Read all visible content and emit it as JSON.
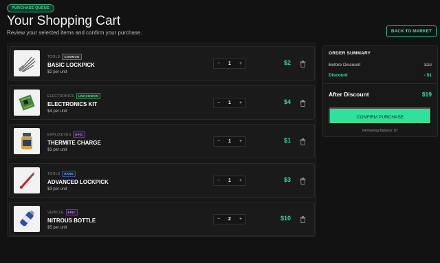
{
  "header": {
    "badge": "PURCHASE QUEUE",
    "title": "Your Shopping Cart",
    "subtitle": "Review your selected items and confirm your purchase.",
    "back_label": "BACK TO MARKET"
  },
  "items": [
    {
      "category": "TOOLS",
      "rarity": "COMMON",
      "name": "BASIC LOCKPICK",
      "unit": "$2 per unit",
      "qty": "1",
      "price": "$2",
      "icon": "lockpick-set-icon"
    },
    {
      "category": "ELECTRONICS",
      "rarity": "UNCOMMON",
      "name": "ELECTRONICS KIT",
      "unit": "$4 per unit",
      "qty": "1",
      "price": "$4",
      "icon": "circuit-board-icon"
    },
    {
      "category": "EXPLOSIVES",
      "rarity": "EPIC",
      "name": "THERMITE CHARGE",
      "unit": "$1 per unit",
      "qty": "1",
      "price": "$1",
      "icon": "thermite-jar-icon"
    },
    {
      "category": "TOOLS",
      "rarity": "RARE",
      "name": "ADVANCED LOCKPICK",
      "unit": "$3 per unit",
      "qty": "1",
      "price": "$3",
      "icon": "red-lockpick-icon"
    },
    {
      "category": "VEHICLE",
      "rarity": "EPIC",
      "name": "NITROUS BOTTLE",
      "unit": "$5 per unit",
      "qty": "2",
      "price": "$10",
      "icon": "nitrous-bottle-icon"
    }
  ],
  "stepper": {
    "minus": "−",
    "plus": "+"
  },
  "summary": {
    "title": "ORDER SUMMARY",
    "before_label": "Before Discount",
    "before_value": "$20",
    "discount_label": "Discount",
    "discount_value": "- $1",
    "after_label": "After Discount",
    "after_value": "$19",
    "confirm_label": "CONFIRM PURCHASE",
    "remaining": "Remaining Balance: $7"
  },
  "colors": {
    "accent": "#2ee29c",
    "common": "#9a9a9a",
    "uncommon": "#38c96a",
    "rare": "#3f7fe0",
    "epic": "#9b4de0"
  }
}
